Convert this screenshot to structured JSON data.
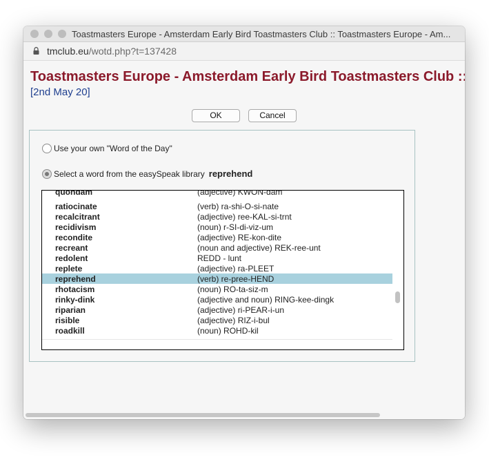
{
  "window": {
    "title": "Toastmasters Europe - Amsterdam Early Bird Toastmasters Club :: Toastmasters Europe - Am..."
  },
  "urlbar": {
    "domain": "tmclub.eu",
    "path": "/wotd.php?t=137428"
  },
  "page": {
    "title": "Toastmasters Europe - Amsterdam Early Bird Toastmasters Club :: Word of the Day",
    "date": "[2nd May 20]"
  },
  "buttons": {
    "ok": "OK",
    "cancel": "Cancel"
  },
  "options": {
    "own_label": "Use your own \"Word of the Day\"",
    "library_label": "Select a word from the easySpeak library",
    "selected_word": "reprehend"
  },
  "words": [
    {
      "word": "quondam",
      "def": "(adjective) KWON-dam"
    },
    {
      "word": "ratiocinate",
      "def": "(verb) ra-shi-O-si-nate"
    },
    {
      "word": "recalcitrant",
      "def": "(adjective) ree-KAL-si-trnt"
    },
    {
      "word": "recidivism",
      "def": "(noun) r-SI-di-viz-um"
    },
    {
      "word": "recondite",
      "def": "(adjective) RE-kon-dite"
    },
    {
      "word": "recreant",
      "def": "(noun and adjective) REK-ree-unt"
    },
    {
      "word": "redolent",
      "def": "REDD - lunt"
    },
    {
      "word": "replete",
      "def": "(adjective) ra-PLEET"
    },
    {
      "word": "reprehend",
      "def": "(verb) re-pree-HEND"
    },
    {
      "word": "rhotacism",
      "def": "(noun) RO-ta-siz-m"
    },
    {
      "word": "rinky-dink",
      "def": "(adjective and noun) RING-kee-dingk"
    },
    {
      "word": "riparian",
      "def": "(adjective) ri-PEAR-i-un"
    },
    {
      "word": "risible",
      "def": "(adjective) RIZ-i-bul"
    },
    {
      "word": "roadkill",
      "def": "(noun) ROHD-kil"
    }
  ],
  "selected_index": 8,
  "colors": {
    "title": "#8b1a2b",
    "date": "#1f3f8f",
    "selection": "#a8d1de"
  }
}
